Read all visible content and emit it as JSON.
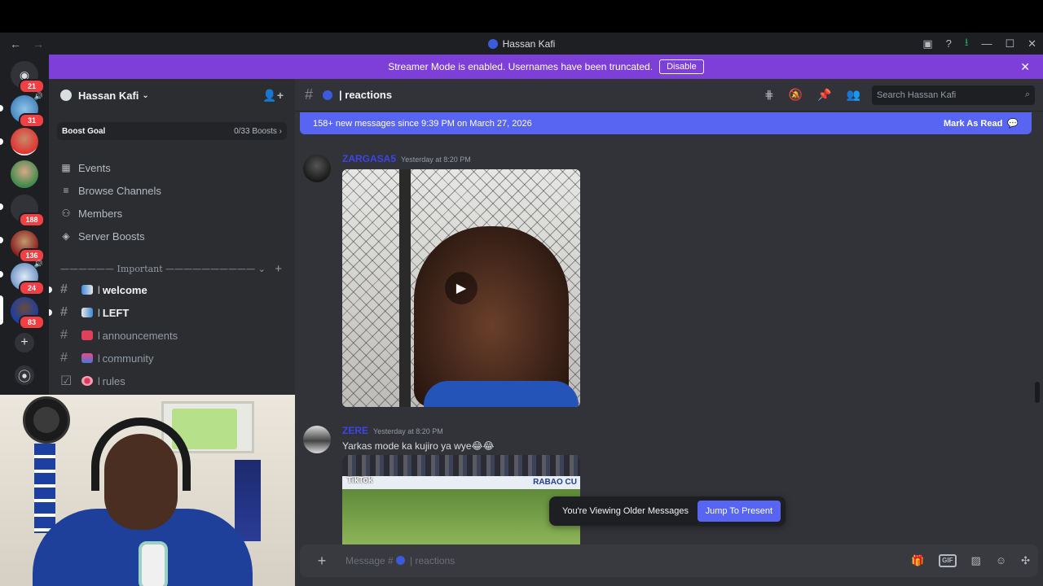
{
  "window": {
    "title": "Hassan Kafi",
    "back": "←",
    "forward": "→",
    "controls": {
      "inbox": "▣",
      "help": "?",
      "download": "⭳",
      "minimize": "—",
      "maximize": "☐",
      "close": "✕"
    }
  },
  "streamer_banner": {
    "text": "Streamer Mode is enabled. Usernames have been truncated.",
    "button": "Disable",
    "close": "✕"
  },
  "rail": {
    "home_badge": "21",
    "servers": [
      {
        "badge": "31"
      },
      {
        "badge": ""
      },
      {
        "badge": ""
      },
      {
        "badge": "188"
      },
      {
        "badge": "136"
      },
      {
        "badge": "24"
      },
      {
        "badge": "83"
      }
    ],
    "add_server": "+",
    "discover": "⦿"
  },
  "sidebar": {
    "server_name": "Hassan Kafi",
    "chevron": "⌄",
    "invite_icon": "👤+",
    "boost_goal": {
      "label": "Boost Goal",
      "progress": "0/33 Boosts ›"
    },
    "nav": [
      {
        "icon": "▦",
        "label": "Events"
      },
      {
        "icon": "≡",
        "label": "Browse Channels"
      },
      {
        "icon": "⚇",
        "label": "Members"
      },
      {
        "icon": "◈",
        "label": "Server Boosts"
      }
    ],
    "category": {
      "label": "—————— Important —————————— ⌄",
      "add": "+"
    },
    "channels": [
      {
        "prefix": "|",
        "label": "welcome",
        "unread": true
      },
      {
        "prefix": "|",
        "label": "LEFT",
        "unread": true
      },
      {
        "prefix": "|",
        "label": "announcements",
        "unread": false
      },
      {
        "prefix": "|",
        "label": "community",
        "unread": false
      },
      {
        "prefix": "|",
        "label": "rules",
        "unread": false
      }
    ]
  },
  "header": {
    "channel_name": "| reactions",
    "search_placeholder": "Search Hassan Kafi"
  },
  "new_messages": {
    "text": "158+ new messages since 9:39 PM on March 27, 2026",
    "action": "Mark As Read"
  },
  "messages": [
    {
      "username": "ZARGASA5",
      "timestamp": "Yesterday at 8:20 PM",
      "text": ""
    },
    {
      "username": "ZERE",
      "timestamp": "Yesterday at 8:20 PM",
      "text": "Yarkas mode ka kujiro ya wye😂😂"
    }
  ],
  "media": {
    "tiktok_label": "TikTok",
    "ad_text": "RABAO CU"
  },
  "older_bar": {
    "text": "You're Viewing Older Messages",
    "button": "Jump To Present"
  },
  "composer": {
    "placeholder_prefix": "Message #",
    "placeholder_channel": "| reactions",
    "gif": "GIF"
  }
}
